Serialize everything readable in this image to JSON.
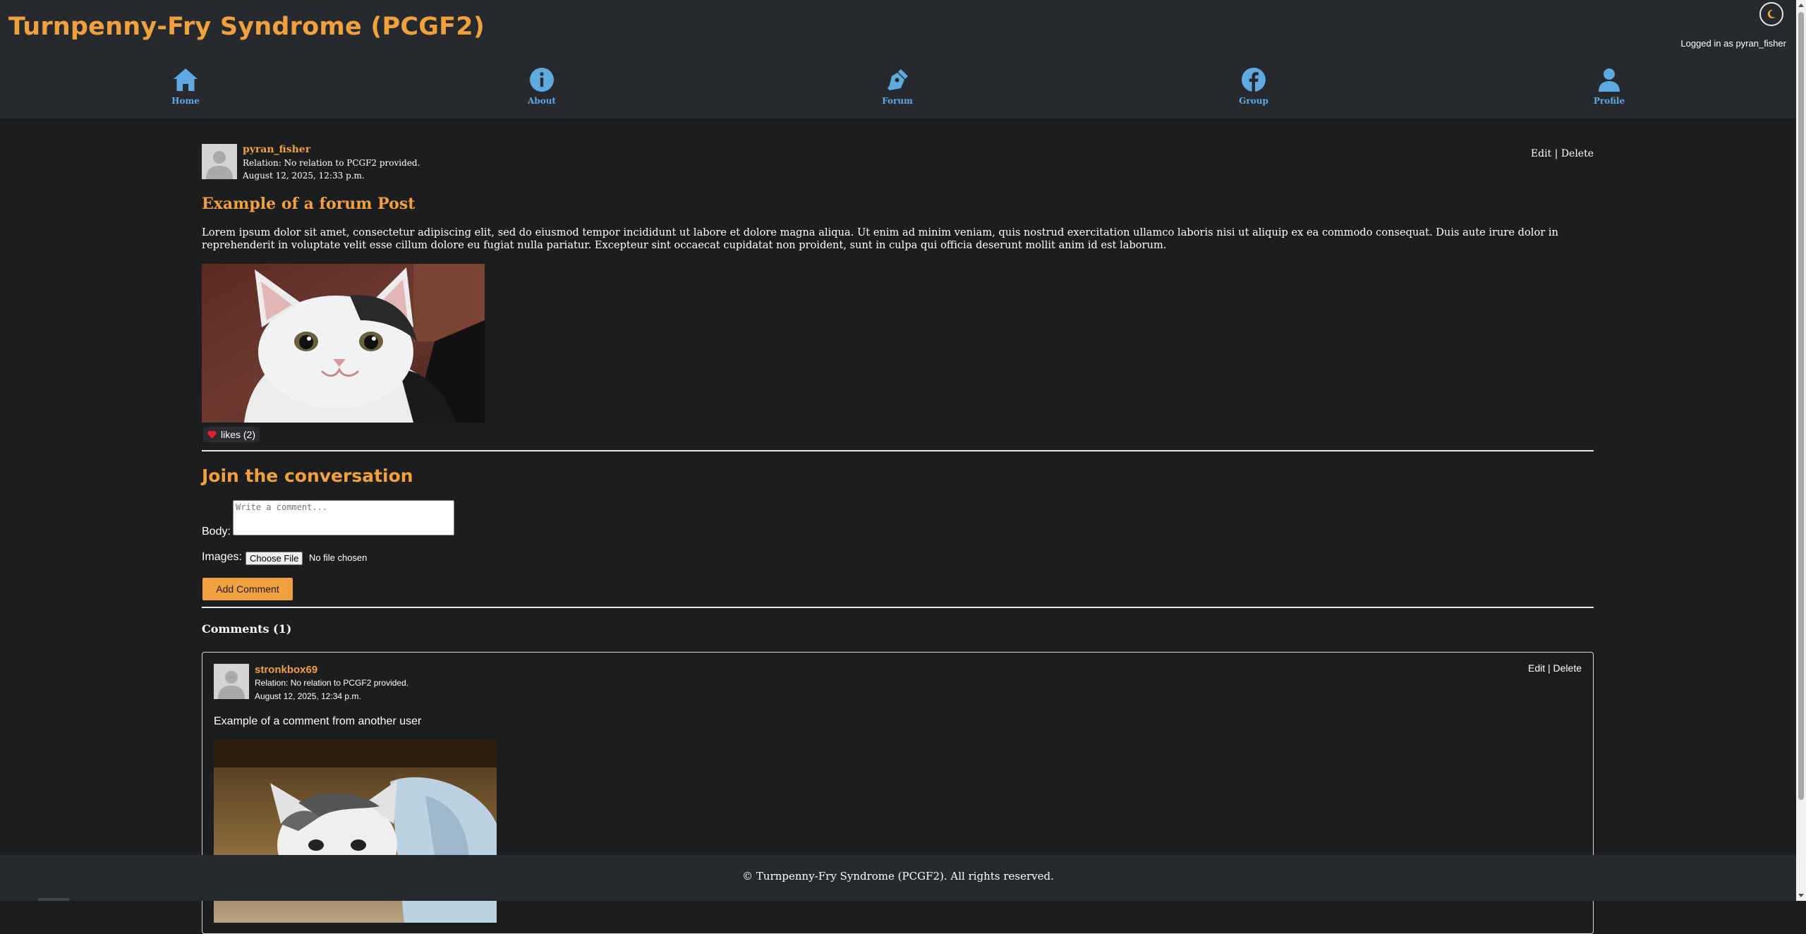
{
  "header": {
    "site_title": "Turnpenny-Fry Syndrome (PCGF2)",
    "login_status": "Logged in as pyran_fisher",
    "theme_toggle_icon": "moon-icon",
    "accent_color": "#f0a03c",
    "nav_color": "#5ea9e0"
  },
  "nav": {
    "items": [
      {
        "label": "Home",
        "icon": "home-icon"
      },
      {
        "label": "About",
        "icon": "info-icon"
      },
      {
        "label": "Forum",
        "icon": "pen-nib-icon"
      },
      {
        "label": "Group",
        "icon": "facebook-icon"
      },
      {
        "label": "Profile",
        "icon": "user-icon"
      }
    ]
  },
  "post": {
    "author": "pyran_fisher",
    "relation": "Relation: No relation to PCGF2 provided.",
    "date": "August 12, 2025, 12:33 p.m.",
    "edit_label": "Edit",
    "delete_label": "Delete",
    "separator": "|",
    "title": "Example of a forum Post",
    "body": "Lorem ipsum dolor sit amet, consectetur adipiscing elit, sed do eiusmod tempor incididunt ut labore et dolore magna aliqua. Ut enim ad minim veniam, quis nostrud exercitation ullamco laboris nisi ut aliquip ex ea commodo consequat. Duis aute irure dolor in reprehenderit in voluptate velit esse cillum dolore eu fugiat nulla pariatur. Excepteur sint occaecat cupidatat non proident, sunt in culpa qui officia deserunt mollit anim id est laborum.",
    "likes_label": "likes (2)",
    "like_icon": "heart-icon"
  },
  "comment_form": {
    "heading": "Join the conversation",
    "body_label": "Body:",
    "body_placeholder": "Write a comment...",
    "images_label": "Images:",
    "file_button": "Choose File",
    "file_status": "No file chosen",
    "submit_label": "Add Comment"
  },
  "comments": {
    "heading": "Comments (1)",
    "items": [
      {
        "author": "stronkbox69",
        "relation": "Relation: No relation to PCGF2 provided.",
        "date": "August 12, 2025, 12:34 p.m.",
        "edit_label": "Edit",
        "delete_label": "Delete",
        "separator": "|",
        "body": "Example of a comment from another user"
      }
    ]
  },
  "footer": {
    "text": "© Turnpenny-Fry Syndrome (PCGF2). All rights reserved."
  }
}
